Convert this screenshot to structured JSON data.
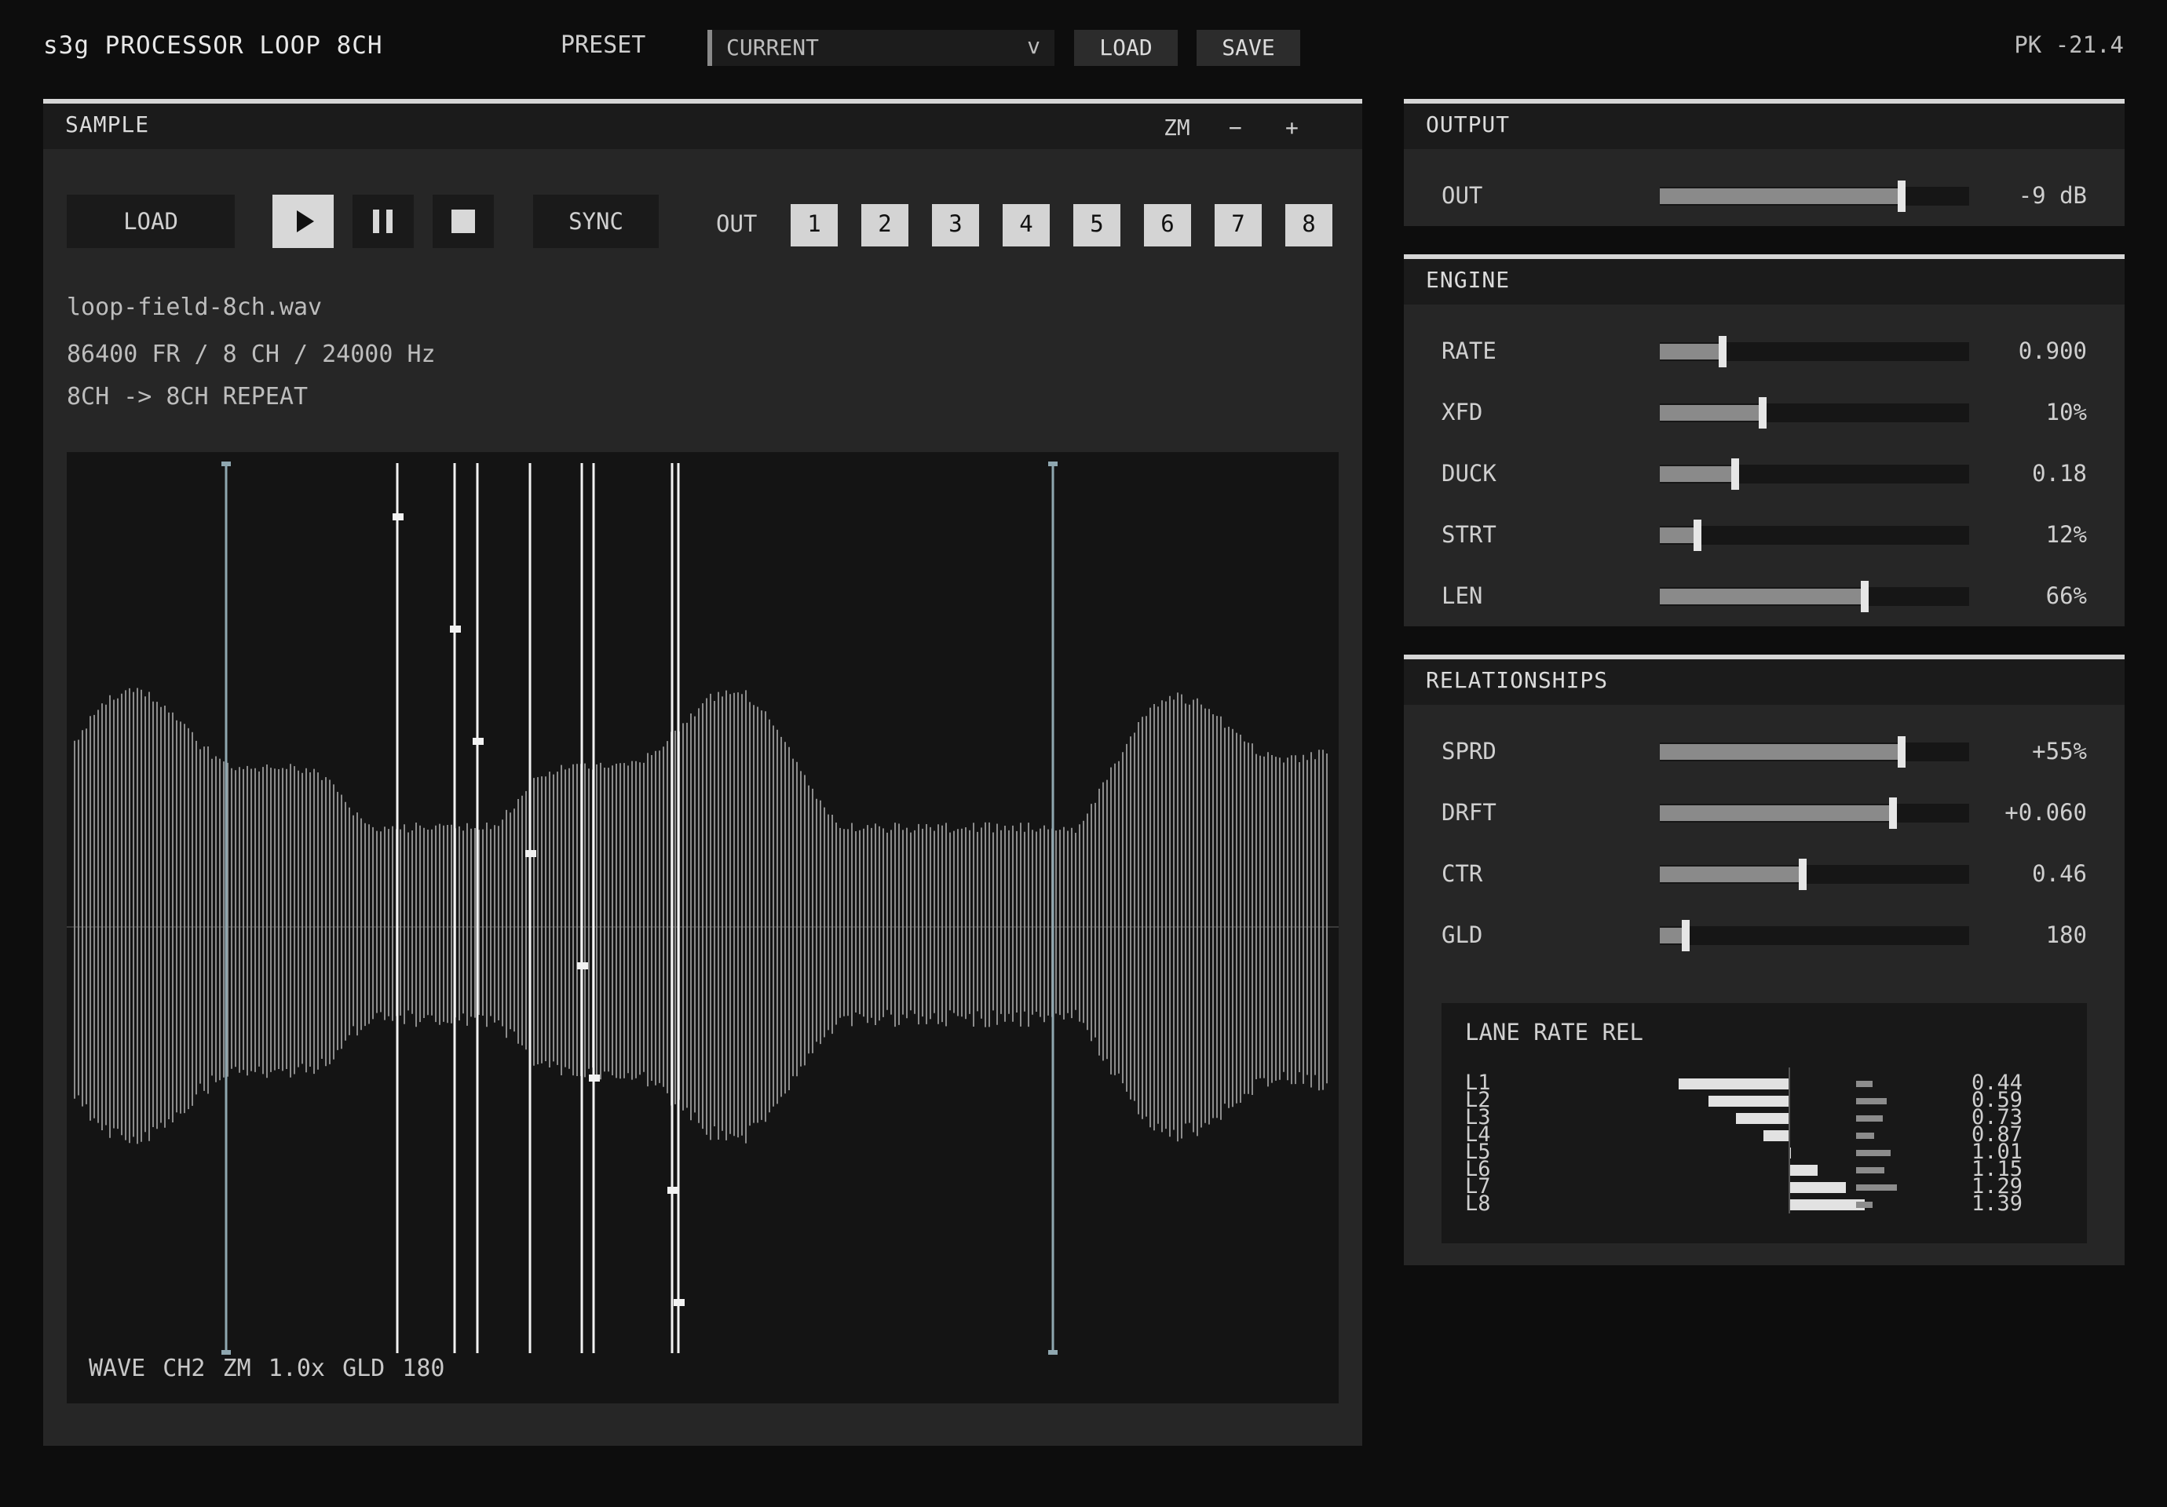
{
  "app": {
    "title": "s3g PROCESSOR LOOP 8CH",
    "peak": "PK -21.4"
  },
  "preset": {
    "label": "PRESET",
    "value": "CURRENT",
    "chevron": "v",
    "load": "LOAD",
    "save": "SAVE"
  },
  "sample": {
    "title": "SAMPLE",
    "zoom_label": "ZM",
    "zoom_minus": "−",
    "zoom_plus": "+",
    "load": "LOAD",
    "sync": "SYNC",
    "out_label": "OUT",
    "outputs": [
      "1",
      "2",
      "3",
      "4",
      "5",
      "6",
      "7",
      "8"
    ],
    "filename": "loop-field-8ch.wav",
    "info": "86400 FR / 8 CH / 24000 Hz",
    "routing": "8CH -> 8CH REPEAT",
    "icons": {
      "play": "play-icon",
      "pause": "pause-icon",
      "stop": "stop-icon"
    },
    "wave": {
      "footer_wave": "WAVE CH2",
      "footer_zoom": "ZM 1.0x",
      "footer_gld": "GLD 180",
      "loop_region": {
        "start": 0.125,
        "end": 0.775
      },
      "lane_playheads": [
        0.26,
        0.305,
        0.323,
        0.364,
        0.405,
        0.414,
        0.476,
        0.481
      ]
    }
  },
  "output": {
    "title": "OUTPUT",
    "rows": [
      {
        "label": "OUT",
        "value": "-9 dB",
        "level": 0.78
      }
    ]
  },
  "engine": {
    "title": "ENGINE",
    "rows": [
      {
        "label": "RATE",
        "value": "0.900",
        "level": 0.2
      },
      {
        "label": "XFD",
        "value": "10%",
        "level": 0.33
      },
      {
        "label": "DUCK",
        "value": "0.18",
        "level": 0.24
      },
      {
        "label": "STRT",
        "value": "12%",
        "level": 0.12
      },
      {
        "label": "LEN",
        "value": "66%",
        "level": 0.66
      }
    ]
  },
  "relationships": {
    "title": "RELATIONSHIPS",
    "rows": [
      {
        "label": "SPRD",
        "value": "+55%",
        "level": 0.78
      },
      {
        "label": "DRFT",
        "value": "+0.060",
        "level": 0.75
      },
      {
        "label": "CTR",
        "value": "0.46",
        "level": 0.46
      },
      {
        "label": "GLD",
        "value": "180",
        "level": 0.08
      }
    ],
    "lane_rate": {
      "title": "LANE RATE REL",
      "lanes": [
        {
          "label": "L1",
          "value": "0.44",
          "rate": 0.44,
          "meter": 0.4
        },
        {
          "label": "L2",
          "value": "0.59",
          "rate": 0.59,
          "meter": 0.75
        },
        {
          "label": "L3",
          "value": "0.73",
          "rate": 0.73,
          "meter": 0.65
        },
        {
          "label": "L4",
          "value": "0.87",
          "rate": 0.87,
          "meter": 0.45
        },
        {
          "label": "L5",
          "value": "1.01",
          "rate": 1.01,
          "meter": 0.85
        },
        {
          "label": "L6",
          "value": "1.15",
          "rate": 1.15,
          "meter": 0.7
        },
        {
          "label": "L7",
          "value": "1.29",
          "rate": 1.29,
          "meter": 1.0
        },
        {
          "label": "L8",
          "value": "1.39",
          "rate": 1.39,
          "meter": 0.4
        }
      ]
    }
  },
  "colors": {
    "accent": "#d6d6d6",
    "marker": "#8fa7b0",
    "wave": "#8c8c8c"
  }
}
